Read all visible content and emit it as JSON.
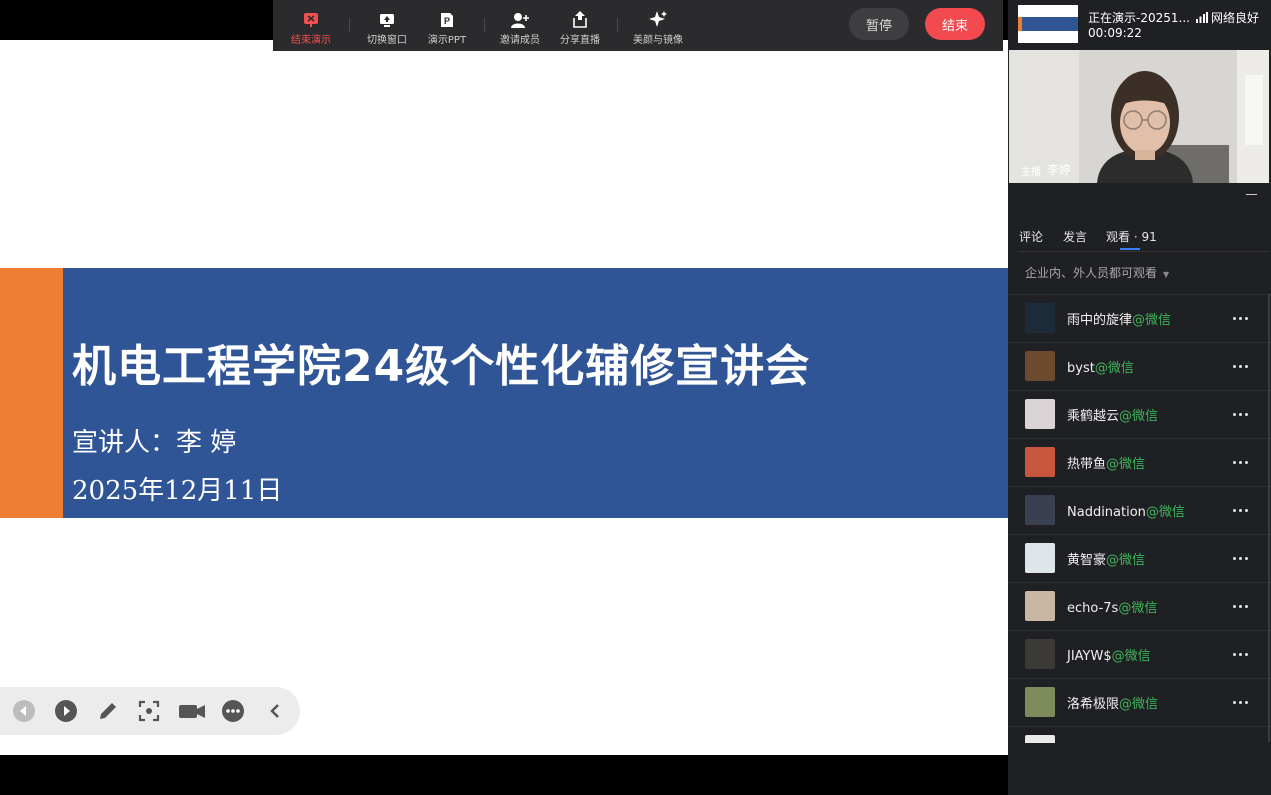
{
  "toolbar": {
    "items": [
      {
        "label": "结束演示",
        "icon": "stop-presenting-icon",
        "active": true
      },
      {
        "label": "切换窗口",
        "icon": "switch-window-icon"
      },
      {
        "label": "演示PPT",
        "icon": "ppt-icon"
      },
      {
        "label": "邀请成员",
        "icon": "invite-member-icon"
      },
      {
        "label": "分享直播",
        "icon": "share-icon"
      },
      {
        "label": "美颜与镜像",
        "icon": "beauty-icon"
      }
    ],
    "pause_label": "暂停",
    "end_label": "结束",
    "accent_color": "#f24a4f"
  },
  "slide": {
    "title": "机电工程学院24级个性化辅修宣讲会",
    "presenter": "宣讲人：李 婷",
    "date": "2025年12月11日",
    "colors": {
      "band": "#2f5597",
      "accent": "#ed7d31"
    }
  },
  "slide_controls": [
    "prev-icon",
    "play-icon",
    "pen-icon",
    "screenshot-icon",
    "camera-icon",
    "more-icon",
    "collapse-left-icon"
  ],
  "status": {
    "title": "正在演示-20251...",
    "elapsed": "00:09:22",
    "network_label": "网络良好"
  },
  "host": {
    "tag": "主播",
    "name": "李婷"
  },
  "tabs": [
    {
      "label": "评论"
    },
    {
      "label": "发言"
    },
    {
      "label": "观看 · 91",
      "active": true
    }
  ],
  "permission": "企业内、外人员都可观看",
  "viewers": [
    {
      "name": "雨中的旋律",
      "source": "@微信",
      "avatar_color": "#1c2b3a"
    },
    {
      "name": "byst",
      "source": "@微信",
      "avatar_color": "#6b4a2e"
    },
    {
      "name": "乘鹤越云",
      "source": "@微信",
      "avatar_color": "#d9d3d6"
    },
    {
      "name": "热带鱼",
      "source": "@微信",
      "avatar_color": "#c8563e"
    },
    {
      "name": "Naddination",
      "source": "@微信",
      "avatar_color": "#3a3f52"
    },
    {
      "name": "黄智豪",
      "source": "@微信",
      "avatar_color": "#dfe6ea"
    },
    {
      "name": "echo-7s",
      "source": "@微信",
      "avatar_color": "#c9b7a3"
    },
    {
      "name": "JIAYW$",
      "source": "@微信",
      "avatar_color": "#3b3a36"
    },
    {
      "name": "洛希极限",
      "source": "@微信",
      "avatar_color": "#7d8a5a"
    },
    {
      "name": "",
      "source": "",
      "avatar_color": "#e9e9e9"
    }
  ]
}
